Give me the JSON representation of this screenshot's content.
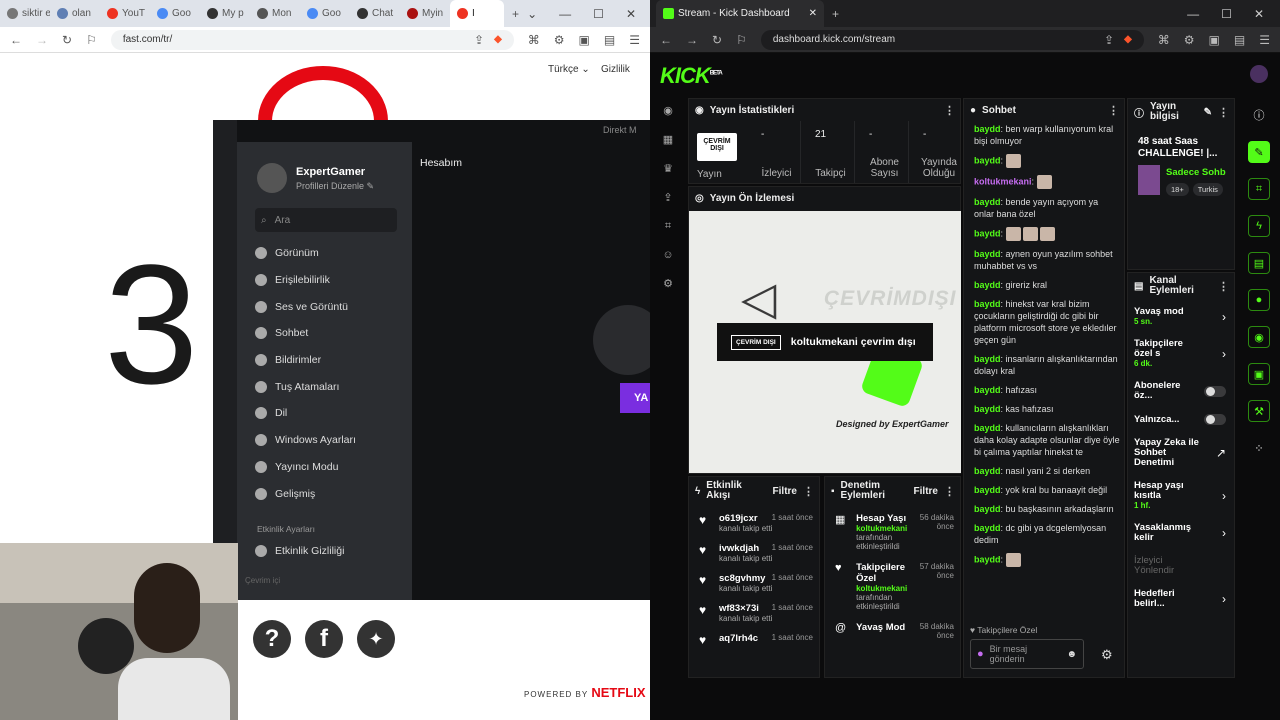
{
  "left_browser": {
    "tabs": [
      {
        "label": "siktir et",
        "color": "#777"
      },
      {
        "label": "olan",
        "color": "#5f7fb4"
      },
      {
        "label": "YouT",
        "color": "#e32"
      },
      {
        "label": "Goo",
        "color": "#4a8af4"
      },
      {
        "label": "My p",
        "color": "#333"
      },
      {
        "label": "Mon",
        "color": "#555"
      },
      {
        "label": "Goo",
        "color": "#4a8af4"
      },
      {
        "label": "Chat",
        "color": "#333"
      },
      {
        "label": "Myin",
        "color": "#a11"
      },
      {
        "label": "I",
        "color": "#e32"
      }
    ],
    "url": "fast.com/tr/",
    "language": "Türkçe",
    "privacy": "Gizlilik",
    "speed_value": "3",
    "powered_by": "POWERED BY",
    "netflix": "NETFLIX"
  },
  "discord": {
    "user_name": "ExpertGamer",
    "edit_profile": "Profilleri Düzenle",
    "search_placeholder": "Ara",
    "top_right": "Direkt M",
    "section_title": "Hesabım",
    "menu": [
      "Görünüm",
      "Erişilebilirlik",
      "Ses ve Görüntü",
      "Sohbet",
      "Bildirimler",
      "Tuş Atamaları",
      "Dil",
      "Windows Ayarları",
      "Yayıncı Modu",
      "Gelişmiş"
    ],
    "group_label": "Etkinlik Ayarları",
    "activity_privacy": "Etkinlik Gizliliği",
    "status": "Çevrim içi",
    "cta": "YA"
  },
  "kick_browser": {
    "tab_title": "Stream - Kick Dashboard",
    "url": "dashboard.kick.com/stream",
    "logo": "KICK",
    "beta": "BETA"
  },
  "stats": {
    "title": "Yayın İstatistikleri",
    "offline": "ÇEVRİM DIŞI",
    "stream_label": "Yayın",
    "items": [
      {
        "value": "-",
        "label": "İzleyici"
      },
      {
        "value": "21",
        "label": "Takipçi"
      },
      {
        "value": "-",
        "label": "Abone Sayısı"
      },
      {
        "value": "-",
        "label": "Yayında Olduğu"
      }
    ]
  },
  "preview": {
    "title": "Yayın Ön İzlemesi",
    "badge": "ÇEVRİM DIŞI",
    "message": "koltukmekani çevrim dışı",
    "watermark": "ÇEVRİMDIŞI",
    "signature": "Designed by ExpertGamer"
  },
  "activity": {
    "title": "Etkinlik Akışı",
    "filter": "Filtre",
    "items": [
      {
        "name": "o619jcxr",
        "time": "1 saat önce",
        "sub": "kanalı takip etti"
      },
      {
        "name": "ivwkdjah",
        "time": "1 saat önce",
        "sub": "kanalı takip etti"
      },
      {
        "name": "sc8gvhmy",
        "time": "1 saat önce",
        "sub": "kanalı takip etti"
      },
      {
        "name": "wf83×73i",
        "time": "1 saat önce",
        "sub": "kanalı takip etti"
      },
      {
        "name": "aq7lrh4c",
        "time": "1 saat önce",
        "sub": ""
      }
    ]
  },
  "moderation": {
    "title": "Denetim Eylemleri",
    "filter": "Filtre",
    "items": [
      {
        "name": "Hesap Yaşı",
        "by": "koltukmekani",
        "by2": "tarafından etkinleştirildi",
        "time": "56 dakika önce",
        "icon": "calendar-icon"
      },
      {
        "name": "Takipçilere Özel",
        "by": "koltukmekani",
        "by2": "tarafından etkinleştirildi",
        "time": "57 dakika önce",
        "icon": "heart-icon"
      },
      {
        "name": "Yavaş Mod",
        "by": "",
        "by2": "",
        "time": "58 dakika önce",
        "icon": "snail-icon"
      }
    ]
  },
  "chat": {
    "title": "Sohbet",
    "messages": [
      {
        "user": "baydd",
        "text": "ben warp kullanıyorum kral bişi olmuyor",
        "emotes": 0,
        "purple": false
      },
      {
        "user": "baydd",
        "text": "",
        "emotes": 1,
        "purple": false
      },
      {
        "user": "koltukmekani",
        "text": "",
        "emotes": 1,
        "purple": true
      },
      {
        "user": "baydd",
        "text": "bende yayın açıyom ya onlar bana özel",
        "emotes": 0,
        "purple": false
      },
      {
        "user": "baydd",
        "text": "",
        "emotes": 3,
        "purple": false
      },
      {
        "user": "baydd",
        "text": "aynen oyun yazılım sohbet muhabbet vs vs",
        "emotes": 0,
        "purple": false
      },
      {
        "user": "baydd",
        "text": "gireriz kral",
        "emotes": 0,
        "purple": false
      },
      {
        "user": "baydd",
        "text": "hinekst var kral bizim çocukların geliştirdiği dc gibi bir platform microsoft store ye ekledıler geçen gün",
        "emotes": 0,
        "purple": false
      },
      {
        "user": "baydd",
        "text": "insanların alışkanlıktarından dolayı kral",
        "emotes": 0,
        "purple": false
      },
      {
        "user": "baydd",
        "text": "hafızası",
        "emotes": 0,
        "purple": false
      },
      {
        "user": "baydd",
        "text": "kas hafızası",
        "emotes": 0,
        "purple": false
      },
      {
        "user": "baydd",
        "text": "kullanıcıların alışkanlıkları daha kolay adapte olsunlar diye öyle bi çalıma yaptılar hinekst te",
        "emotes": 0,
        "purple": false
      },
      {
        "user": "baydd",
        "text": "nasıl yani 2 si derken",
        "emotes": 0,
        "purple": false
      },
      {
        "user": "baydd",
        "text": "yok kral bu banaayit değil",
        "emotes": 0,
        "purple": false
      },
      {
        "user": "baydd",
        "text": "bu başkasının arkadaşların",
        "emotes": 0,
        "purple": false
      },
      {
        "user": "baydd",
        "text": "dc gibi ya dcgelemlyosan dedim",
        "emotes": 0,
        "purple": false
      },
      {
        "user": "baydd",
        "text": "",
        "emotes": 1,
        "purple": false
      }
    ],
    "followers_only": "Takipçilere Özel",
    "input_placeholder": "Bir mesaj gönderin"
  },
  "stream_info": {
    "title": "Yayın bilgisi",
    "stream_title": "48 saat Saas CHALLENGE! |...",
    "category": "Sadece Sohb",
    "tags": [
      "18+",
      "Turkis"
    ]
  },
  "channel_actions": {
    "title": "Kanal Eylemleri",
    "items": [
      {
        "label": "Yavaş mod",
        "sub": "5 sn.",
        "ctrl": "arrow",
        "dim": false
      },
      {
        "label": "Takipçilere özel s",
        "sub": "6 dk.",
        "ctrl": "arrow",
        "dim": false
      },
      {
        "label": "Abonelere öz...",
        "sub": "",
        "ctrl": "toggle",
        "dim": false
      },
      {
        "label": "Yalnızca...",
        "sub": "",
        "ctrl": "toggle",
        "dim": false
      },
      {
        "label": "Yapay Zeka ile Sohbet Denetimi",
        "sub": "",
        "ctrl": "ext",
        "dim": false
      },
      {
        "label": "Hesap yaşı kısıtla",
        "sub": "1 hf.",
        "ctrl": "arrow",
        "dim": false
      },
      {
        "label": "Yasaklanmış kelir",
        "sub": "",
        "ctrl": "arrow",
        "dim": false
      },
      {
        "label": "İzleyici Yönlendir",
        "sub": "",
        "ctrl": "none",
        "dim": true
      },
      {
        "label": "Hedefleri belirl...",
        "sub": "",
        "ctrl": "arrow",
        "dim": false
      }
    ]
  },
  "colors": {
    "kick_green": "#53fc18",
    "brave_orange": "#fb542b",
    "discord_purple": "#5865f2",
    "netflix_red": "#e50914"
  }
}
